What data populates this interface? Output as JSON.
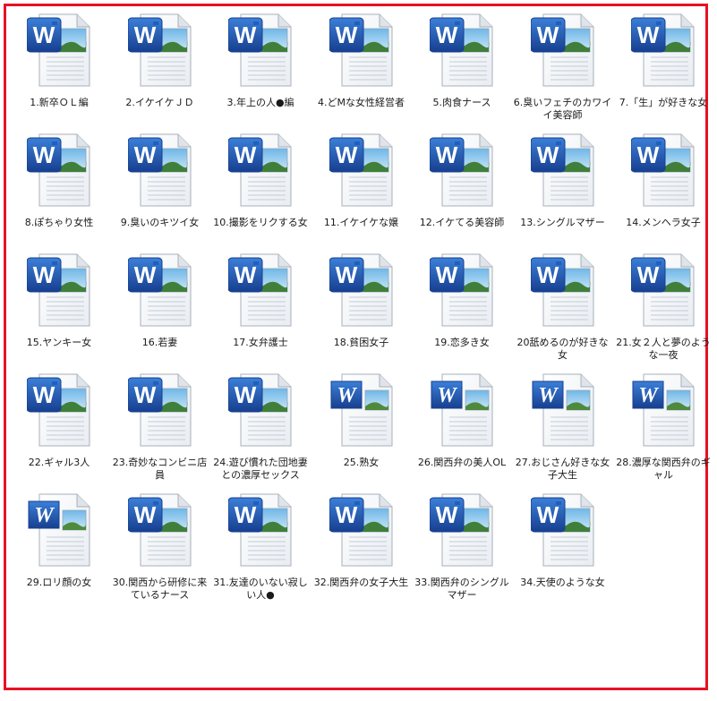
{
  "files": [
    {
      "name": "1.新卒ＯＬ編",
      "icon": "word-document-icon"
    },
    {
      "name": "2.イケイケＪＤ",
      "icon": "word-document-icon"
    },
    {
      "name": "3.年上の人●編",
      "icon": "word-document-icon"
    },
    {
      "name": "4.どMな女性経営者",
      "icon": "word-document-icon"
    },
    {
      "name": "5.肉食ナース",
      "icon": "word-document-icon"
    },
    {
      "name": "6.臭いフェチのカワイイ美容師",
      "icon": "word-document-icon"
    },
    {
      "name": "7.「生」が好きな女",
      "icon": "word-document-icon"
    },
    {
      "name": "8.ぽちゃり女性",
      "icon": "word-document-icon"
    },
    {
      "name": "9.臭いのキツイ女",
      "icon": "word-document-icon"
    },
    {
      "name": "10.撮影をリクする女",
      "icon": "word-document-icon"
    },
    {
      "name": "11.イケイケな嬢",
      "icon": "word-document-icon"
    },
    {
      "name": "12.イケてる美容師",
      "icon": "word-document-icon"
    },
    {
      "name": "13.シングルマザー",
      "icon": "word-document-icon"
    },
    {
      "name": "14.メンヘラ女子",
      "icon": "word-document-icon"
    },
    {
      "name": "15.ヤンキー女",
      "icon": "word-document-icon"
    },
    {
      "name": "16.若妻",
      "icon": "word-document-icon"
    },
    {
      "name": "17.女弁護士",
      "icon": "word-document-icon"
    },
    {
      "name": "18.貧困女子",
      "icon": "word-document-icon"
    },
    {
      "name": "19.恋多き女",
      "icon": "word-document-icon"
    },
    {
      "name": "20舐めるのが好きな女",
      "icon": "word-document-icon"
    },
    {
      "name": "21.女２人と夢のような一夜",
      "icon": "word-document-icon"
    },
    {
      "name": "22.ギャル3人",
      "icon": "word-document-icon"
    },
    {
      "name": "23.奇妙なコンビニ店員",
      "icon": "word-document-icon"
    },
    {
      "name": "24.遊び慣れた団地妻との濃厚セックス",
      "icon": "word-document-icon"
    },
    {
      "name": "25.熟女",
      "icon": "word-legacy-document-icon"
    },
    {
      "name": "26.関西弁の美人OL",
      "icon": "word-legacy-document-icon"
    },
    {
      "name": "27.おじさん好きな女子大生",
      "icon": "word-legacy-document-icon"
    },
    {
      "name": "28.濃厚な関西弁のギャル",
      "icon": "word-legacy-document-icon"
    },
    {
      "name": "29.ロリ顔の女",
      "icon": "word-legacy-document-icon"
    },
    {
      "name": "30.関西から研修に来ているナース",
      "icon": "word-document-icon"
    },
    {
      "name": "31.友達のいない寂しい人●",
      "icon": "word-document-icon"
    },
    {
      "name": "32.関西弁の女子大生",
      "icon": "word-document-icon"
    },
    {
      "name": "33.関西弁のシングルマザー",
      "icon": "word-document-icon"
    },
    {
      "name": "34.天使のような女",
      "icon": "word-document-icon"
    }
  ],
  "colors": {
    "frame_border": "#e81123",
    "word_blue": "#1f5fbf",
    "word_blue_dark": "#173f8f",
    "page_bg": "#ffffff"
  }
}
